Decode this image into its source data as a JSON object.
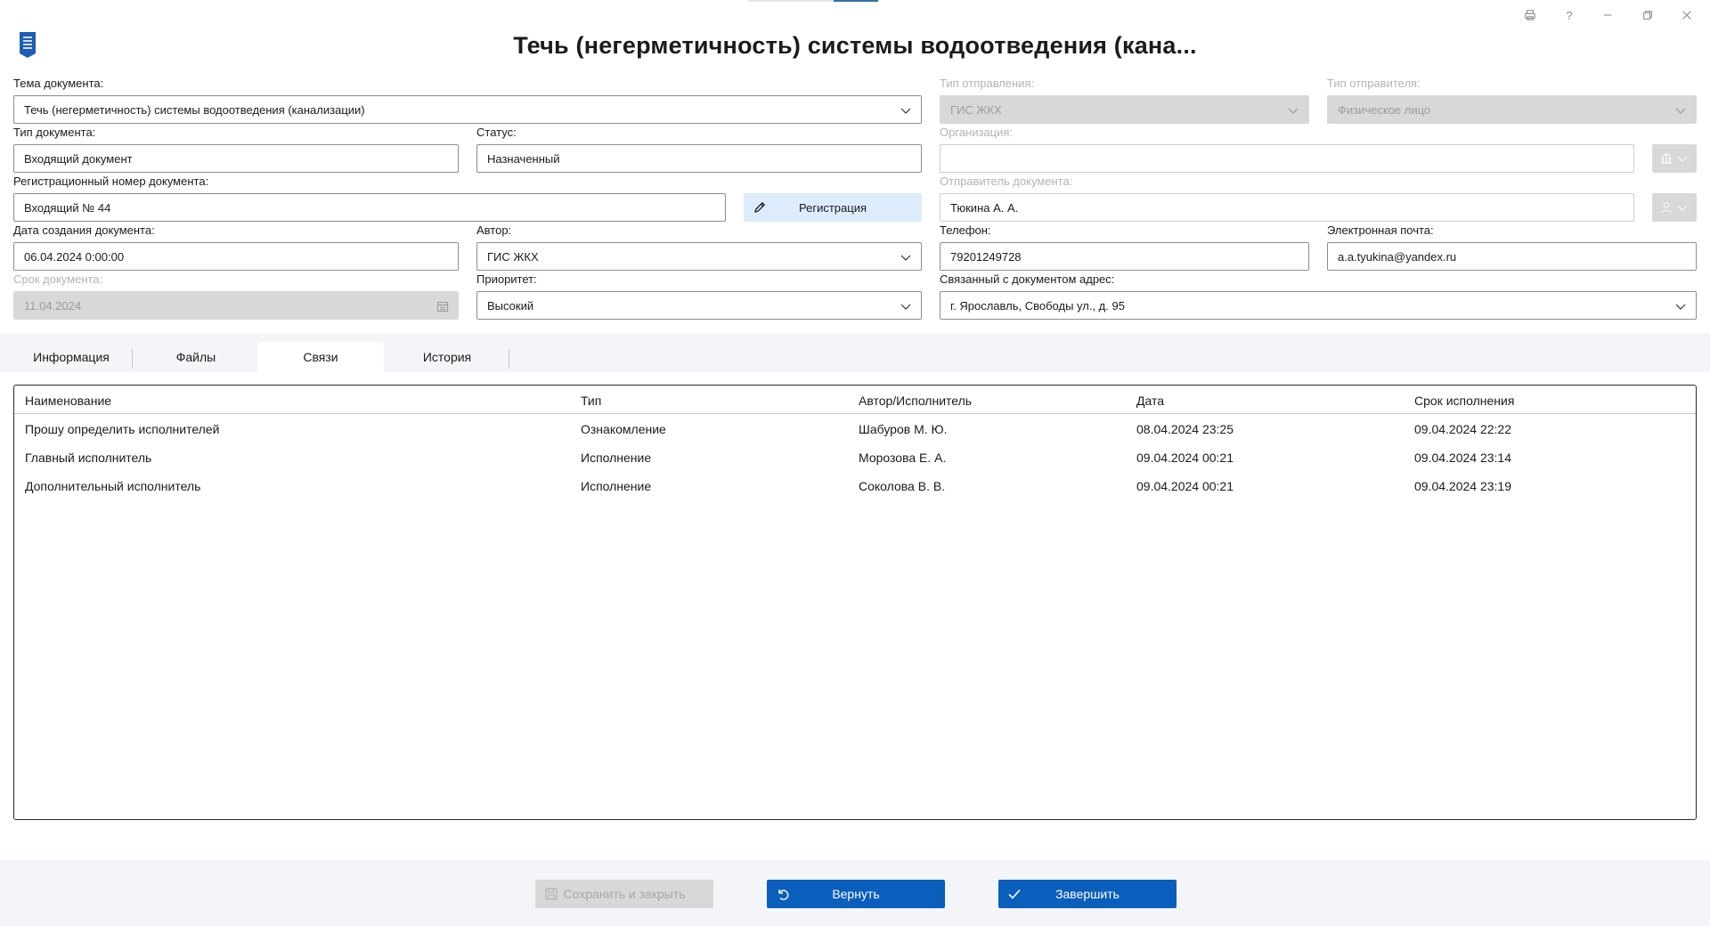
{
  "window": {
    "controls": [
      "print-icon",
      "help-icon",
      "minimize-icon",
      "restore-icon",
      "close-icon"
    ],
    "help_glyph": "?"
  },
  "header": {
    "title": "Течь (негерметичность) системы водоотведения (кана..."
  },
  "form": {
    "subject": {
      "label": "Тема документа:",
      "value": "Течь (негерметичность) системы водоотведения (канализации)"
    },
    "send_type": {
      "label": "Тип отправления:",
      "value": "ГИС ЖКХ"
    },
    "sender_type": {
      "label": "Тип отправителя:",
      "value": "Физическое лицо"
    },
    "doc_type": {
      "label": "Тип документа:",
      "value": "Входящий документ"
    },
    "status": {
      "label": "Статус:",
      "value": "Назначенный"
    },
    "organization": {
      "label": "Организация:",
      "value": ""
    },
    "reg_number": {
      "label": "Регистрационный номер документа:",
      "value": "Входящий № 44"
    },
    "register_button": "Регистрация",
    "sender": {
      "label": "Отправитель документа:",
      "value": "Тюкина А. А."
    },
    "created": {
      "label": "Дата создания документа:",
      "value": "06.04.2024 0:00:00"
    },
    "author": {
      "label": "Автор:",
      "value": "ГИС ЖКХ"
    },
    "phone": {
      "label": "Телефон:",
      "value": "79201249728"
    },
    "email": {
      "label": "Электронная почта:",
      "value": "a.a.tyukina@yandex.ru"
    },
    "deadline": {
      "label": "Срок документа:",
      "value": "11.04.2024"
    },
    "priority": {
      "label": "Приоритет:",
      "value": "Высокий"
    },
    "address": {
      "label": "Связанный с документом адрес:",
      "value": "г. Ярославль, Свободы ул., д. 95"
    }
  },
  "tabs": [
    {
      "label": "Информация",
      "active": false
    },
    {
      "label": "Файлы",
      "active": false
    },
    {
      "label": "Связи",
      "active": true
    },
    {
      "label": "История",
      "active": false
    }
  ],
  "table": {
    "columns": [
      "Наименование",
      "Тип",
      "Автор/Исполнитель",
      "Дата",
      "Срок исполнения"
    ],
    "rows": [
      [
        "Прошу определить исполнителей",
        "Ознакомление",
        "Шабуров М. Ю.",
        "08.04.2024 23:25",
        "09.04.2024 22:22"
      ],
      [
        "Главный исполнитель",
        "Исполнение",
        "Морозова Е. А.",
        "09.04.2024 00:21",
        "09.04.2024 23:14"
      ],
      [
        "Дополнительный исполнитель",
        "Исполнение",
        "Соколова В. В.",
        "09.04.2024 00:21",
        "09.04.2024 23:19"
      ]
    ]
  },
  "footer": {
    "save_close": "Сохранить и закрыть",
    "return": "Вернуть",
    "complete": "Завершить"
  },
  "colors": {
    "primary": "#0a5ebc",
    "register_bg": "#dcecfb",
    "disabled_bg": "#d8d8d8",
    "panel_bg": "#f3f5f8"
  }
}
